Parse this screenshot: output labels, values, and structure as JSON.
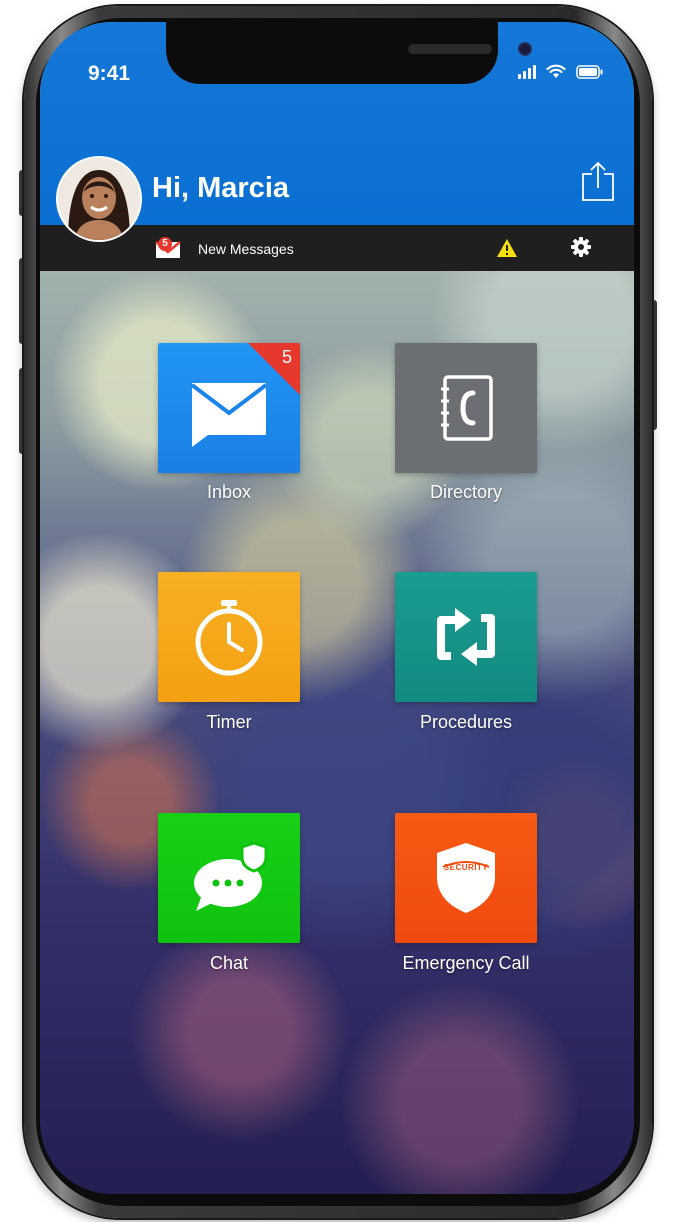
{
  "status_bar": {
    "time": "9:41"
  },
  "header": {
    "greeting": "Hi, Marcia"
  },
  "notification_bar": {
    "message_count": "5",
    "message_label": "New Messages"
  },
  "tiles": [
    {
      "label": "Inbox",
      "badge": "5",
      "color": "#1f8fee"
    },
    {
      "label": "Directory",
      "color": "#6b6e73"
    },
    {
      "label": "Timer",
      "color": "#f6ac1c"
    },
    {
      "label": "Procedures",
      "color": "#17958a"
    },
    {
      "label": "Chat",
      "color": "#13c913"
    },
    {
      "label": "Emergency Call",
      "color": "#f55212",
      "shield_text": "SECURITY"
    }
  ],
  "colors": {
    "header": "#0a6fd2",
    "notification_bar": "#1f1f1f",
    "badge": "#e8382d",
    "warning": "#f5e00d"
  }
}
